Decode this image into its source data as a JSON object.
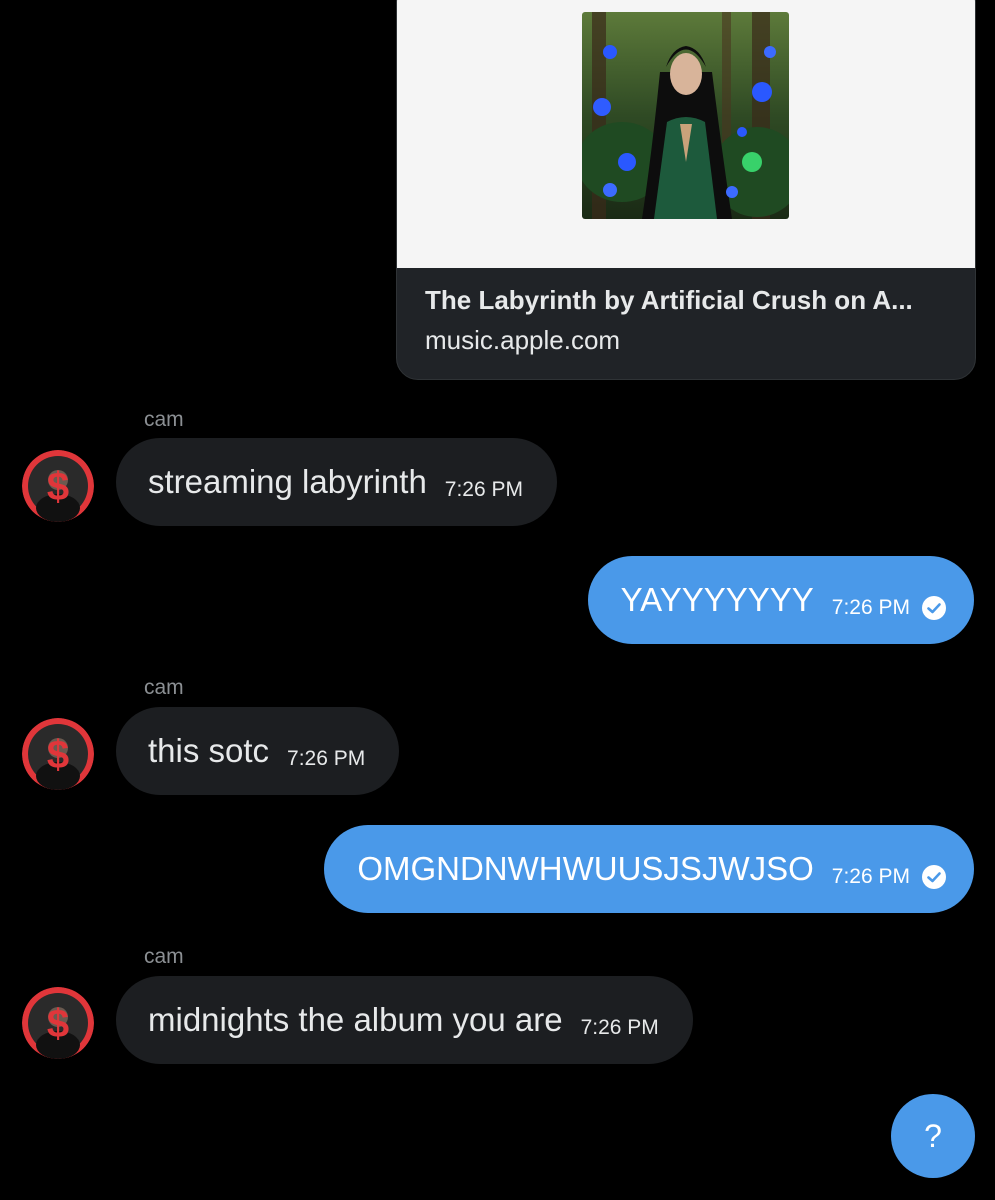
{
  "link_preview": {
    "title": "The Labyrinth by Artificial Crush on A...",
    "domain": "music.apple.com",
    "image_icon": "album-art-image"
  },
  "messages": [
    {
      "direction": "incoming",
      "sender": "cam",
      "text": "streaming labyrinth",
      "time": "7:26 PM"
    },
    {
      "direction": "outgoing",
      "text": "YAYYYYYYY",
      "time": "7:26 PM",
      "status_icon": "read-check-icon"
    },
    {
      "direction": "incoming",
      "sender": "cam",
      "text": "this sotc",
      "time": "7:26 PM"
    },
    {
      "direction": "outgoing",
      "text": "OMGNDNWHWUUSJSJWJSO",
      "time": "7:26 PM",
      "status_icon": "read-check-icon"
    },
    {
      "direction": "incoming",
      "sender": "cam",
      "text": "midnights the album you are",
      "time": "7:26 PM"
    }
  ],
  "help_button": {
    "label": "?"
  },
  "colors": {
    "background": "#000000",
    "incoming_bubble": "#1c1e21",
    "outgoing_bubble": "#4a99e9",
    "card_background": "#202327",
    "sender_name": "#8b8f93",
    "avatar_ring": "#e0363a"
  }
}
